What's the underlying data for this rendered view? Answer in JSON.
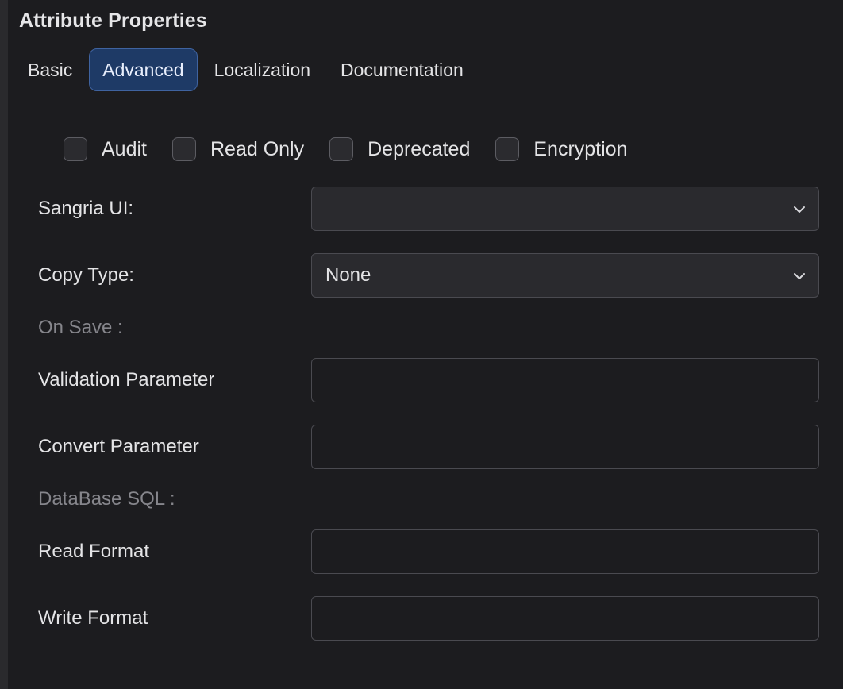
{
  "panel": {
    "title": "Attribute Properties"
  },
  "tabs": [
    {
      "label": "Basic",
      "active": false
    },
    {
      "label": "Advanced",
      "active": true
    },
    {
      "label": "Localization",
      "active": false
    },
    {
      "label": "Documentation",
      "active": false
    }
  ],
  "checkboxes": [
    {
      "label": "Audit",
      "checked": false
    },
    {
      "label": "Read Only",
      "checked": false
    },
    {
      "label": "Deprecated",
      "checked": false
    },
    {
      "label": "Encryption",
      "checked": false
    }
  ],
  "fields": {
    "sangria_ui": {
      "label": "Sangria UI:",
      "value": ""
    },
    "copy_type": {
      "label": "Copy Type:",
      "value": "None"
    },
    "on_save_section": "On Save :",
    "validation_parameter": {
      "label": "Validation Parameter",
      "value": ""
    },
    "convert_parameter": {
      "label": "Convert Parameter",
      "value": ""
    },
    "database_sql_section": "DataBase SQL :",
    "read_format": {
      "label": "Read Format",
      "value": ""
    },
    "write_format": {
      "label": "Write Format",
      "value": ""
    }
  },
  "icons": {
    "dropdown": "chevron-down-icon"
  },
  "colors": {
    "background": "#1c1c1f",
    "active_tab_bg": "#1e3a66",
    "active_tab_border": "#3f63a0",
    "section_label": "#86868c"
  }
}
